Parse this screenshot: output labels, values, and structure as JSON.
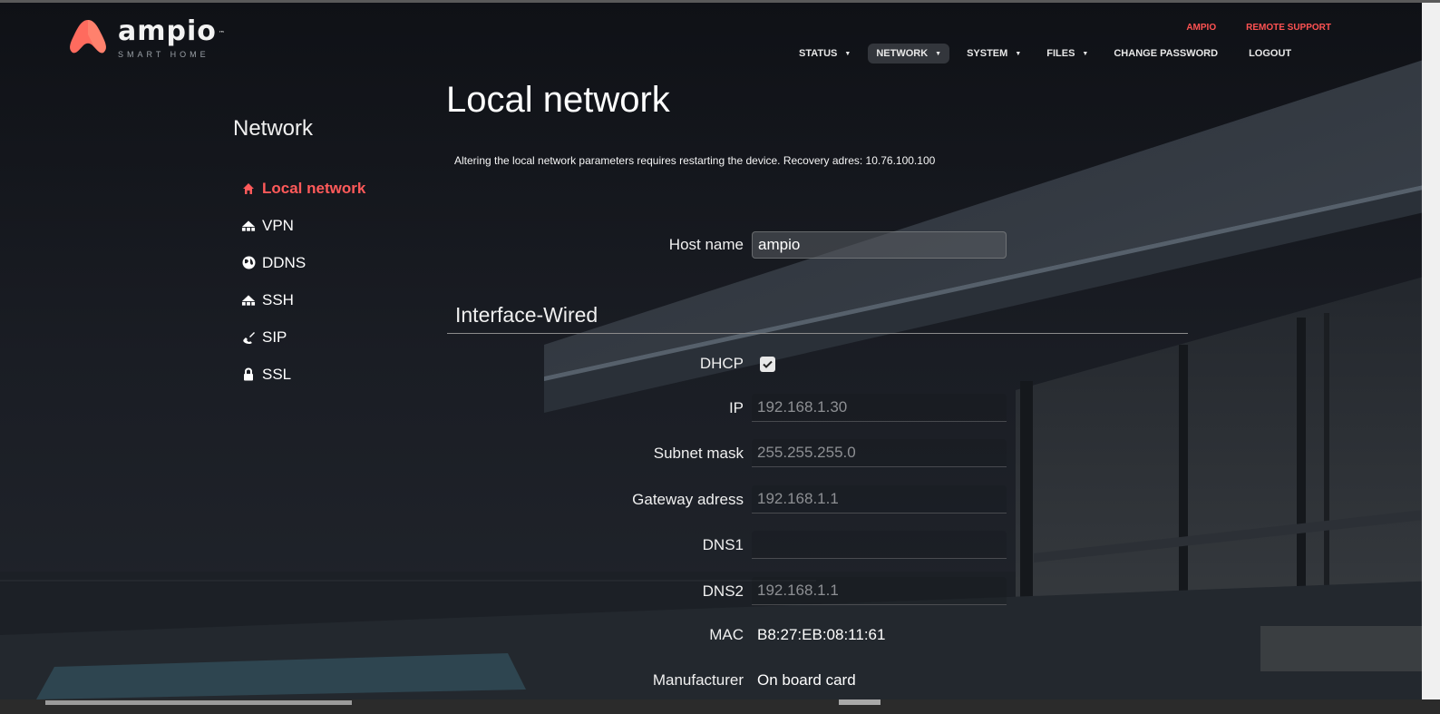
{
  "brand": {
    "name": "ampio",
    "trademark": "™",
    "tagline": "SMART HOME"
  },
  "top_links": [
    "AMPIO",
    "REMOTE SUPPORT"
  ],
  "nav": [
    {
      "label": "STATUS",
      "dropdown": true,
      "active": false
    },
    {
      "label": "NETWORK",
      "dropdown": true,
      "active": true
    },
    {
      "label": "SYSTEM",
      "dropdown": true,
      "active": false
    },
    {
      "label": "FILES",
      "dropdown": true,
      "active": false
    },
    {
      "label": "CHANGE PASSWORD",
      "dropdown": false,
      "active": false
    },
    {
      "label": "LOGOUT",
      "dropdown": false,
      "active": false
    }
  ],
  "sidebar": {
    "title": "Network",
    "items": [
      {
        "label": "Local network",
        "icon": "home-icon",
        "active": true
      },
      {
        "label": "VPN",
        "icon": "sitemap-icon"
      },
      {
        "label": "DDNS",
        "icon": "globe-icon"
      },
      {
        "label": "SSH",
        "icon": "sitemap-icon"
      },
      {
        "label": "SIP",
        "icon": "phone-icon"
      },
      {
        "label": "SSL",
        "icon": "lock-icon"
      }
    ]
  },
  "main": {
    "title": "Local network",
    "notice": "Altering the local network parameters requires restarting the device. Recovery adres: 10.76.100.100",
    "host_name": {
      "label": "Host name",
      "value": "ampio"
    },
    "section_title": "Interface-Wired",
    "dhcp": {
      "label": "DHCP",
      "checked": true
    },
    "ip": {
      "label": "IP",
      "value": "192.168.1.30"
    },
    "subnet": {
      "label": "Subnet mask",
      "value": "255.255.255.0"
    },
    "gateway": {
      "label": "Gateway adress",
      "value": "192.168.1.1"
    },
    "dns1": {
      "label": "DNS1",
      "value": ""
    },
    "dns2": {
      "label": "DNS2",
      "value": "192.168.1.1"
    },
    "mac": {
      "label": "MAC",
      "value": "B8:27:EB:08:11:61"
    },
    "manufacturer": {
      "label": "Manufacturer",
      "value": "On board card"
    }
  },
  "colors": {
    "accent": "#ff5252",
    "background": "#13151a"
  }
}
